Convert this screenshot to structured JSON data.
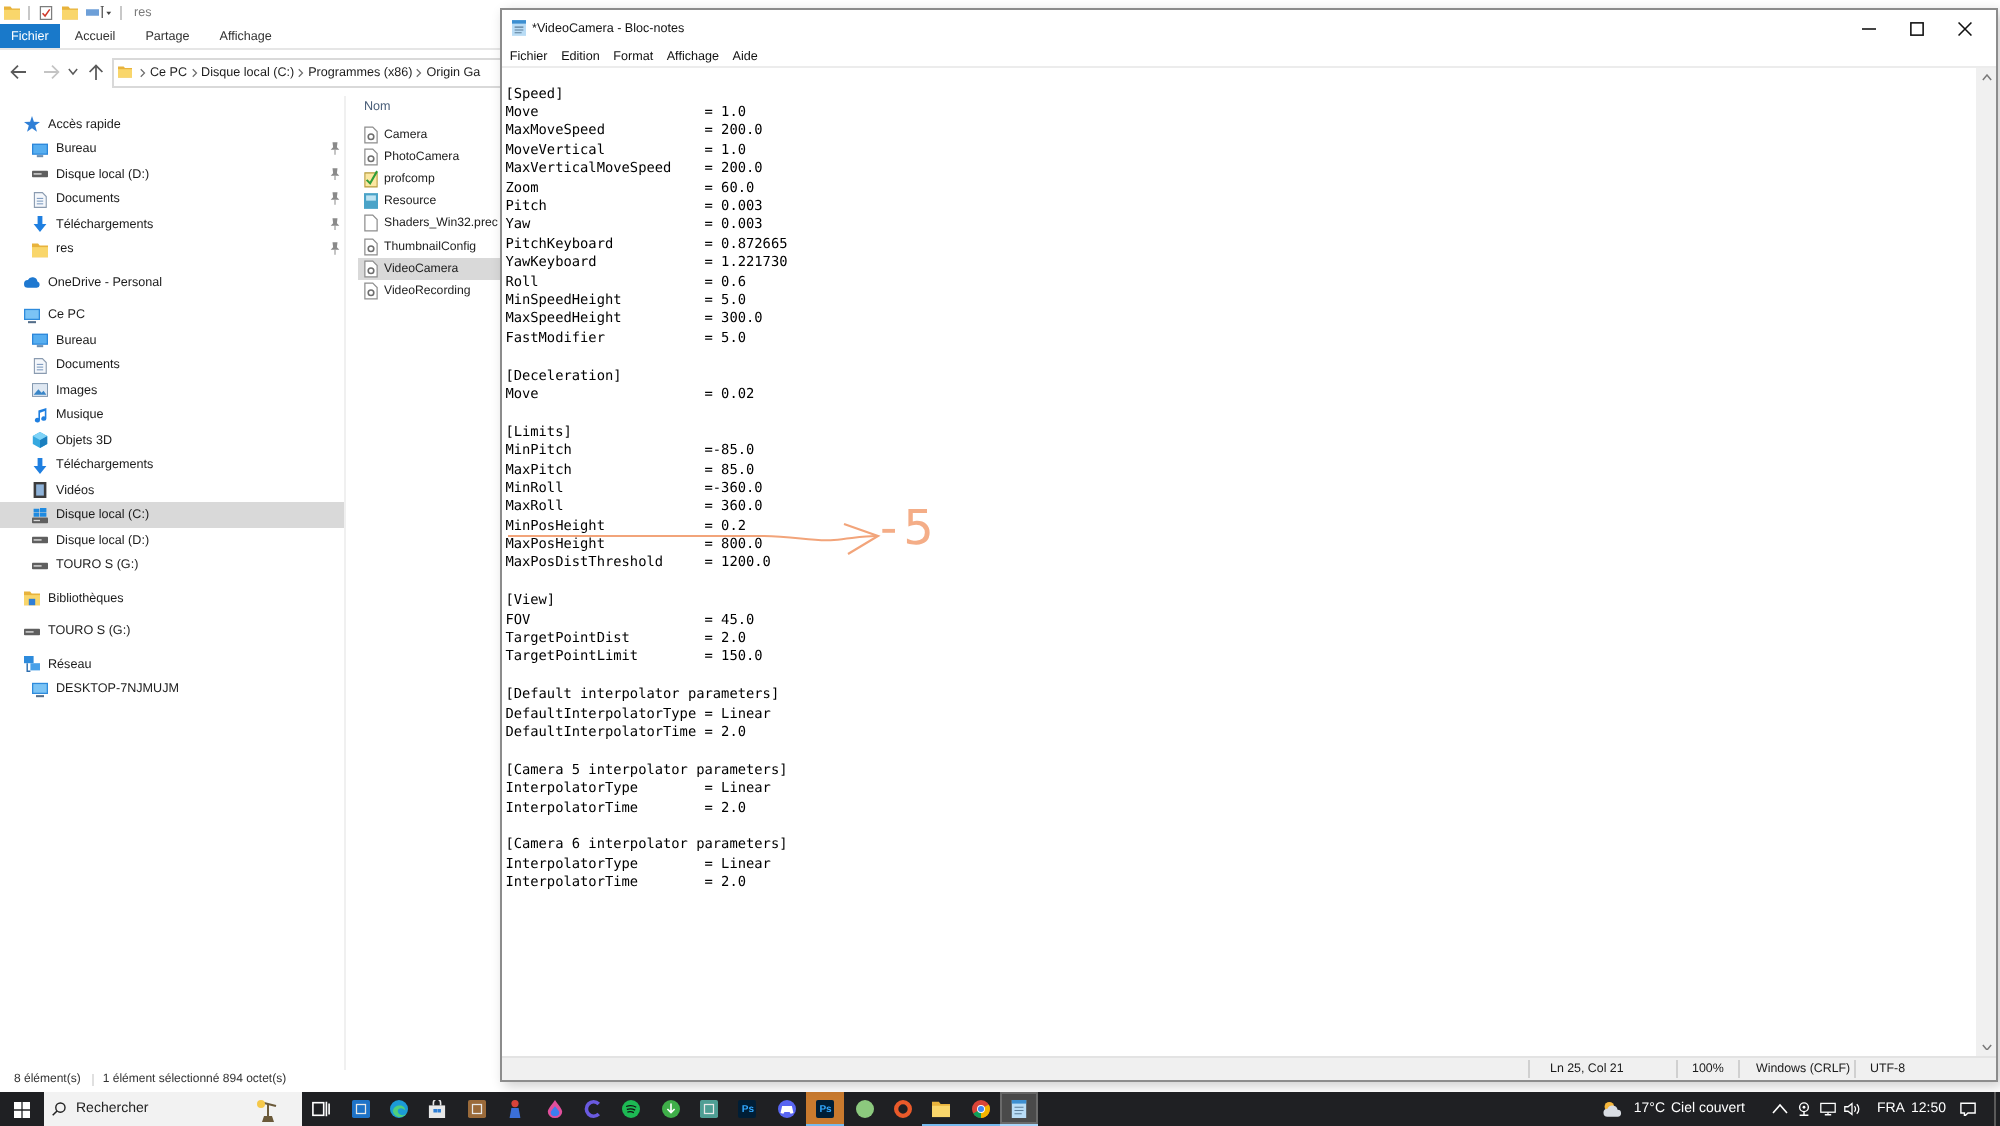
{
  "explorer": {
    "title": "res",
    "ribbon_tabs": [
      {
        "label": "Fichier",
        "kind": "menu"
      },
      {
        "label": "Accueil",
        "kind": "tab"
      },
      {
        "label": "Partage",
        "kind": "tab"
      },
      {
        "label": "Affichage",
        "kind": "tab"
      }
    ],
    "navigation": [
      {
        "kind": "back",
        "disabled": false
      },
      {
        "kind": "forward",
        "disabled": true
      },
      {
        "kind": "recent",
        "disabled": false
      },
      {
        "kind": "up",
        "disabled": false
      }
    ],
    "address_bar": {
      "segments": [
        "Ce PC",
        "Disque local (C:)",
        "Programmes (x86)",
        "Origin Ga"
      ]
    },
    "sidebar": {
      "items": [
        {
          "label": "Accès rapide",
          "kind": "quick-access",
          "pinned": false,
          "selected": false,
          "children": [
            {
              "label": "Bureau",
              "kind": "desktop",
              "pinned": true,
              "selected": false
            },
            {
              "label": "Disque local (D:)",
              "kind": "drive",
              "pinned": true,
              "selected": false
            },
            {
              "label": "Documents",
              "kind": "documents",
              "pinned": true,
              "selected": false
            },
            {
              "label": "Téléchargements",
              "kind": "downloads",
              "pinned": true,
              "selected": false
            },
            {
              "label": "res",
              "kind": "folder",
              "pinned": true,
              "selected": false
            }
          ]
        },
        {
          "label": "OneDrive - Personal",
          "kind": "cloud",
          "pinned": false,
          "selected": false
        },
        {
          "label": "Ce PC",
          "kind": "computer",
          "pinned": false,
          "selected": false,
          "children": [
            {
              "label": "Bureau",
              "kind": "desktop",
              "pinned": false,
              "selected": false
            },
            {
              "label": "Documents",
              "kind": "documents",
              "pinned": false,
              "selected": false
            },
            {
              "label": "Images",
              "kind": "pictures",
              "pinned": false,
              "selected": false
            },
            {
              "label": "Musique",
              "kind": "music",
              "pinned": false,
              "selected": false
            },
            {
              "label": "Objets 3D",
              "kind": "objects",
              "pinned": false,
              "selected": false
            },
            {
              "label": "Téléchargements",
              "kind": "downloads",
              "pinned": false,
              "selected": false
            },
            {
              "label": "Vidéos",
              "kind": "videos",
              "pinned": false,
              "selected": false
            },
            {
              "label": "Disque local (C:)",
              "kind": "system-drive",
              "pinned": false,
              "selected": true
            },
            {
              "label": "Disque local (D:)",
              "kind": "drive",
              "pinned": false,
              "selected": false
            },
            {
              "label": "TOURO S (G:)",
              "kind": "drive",
              "pinned": false,
              "selected": false
            }
          ]
        },
        {
          "label": "Bibliothèques",
          "kind": "libraries",
          "pinned": false,
          "selected": false
        },
        {
          "label": "TOURO S (G:)",
          "kind": "drive",
          "pinned": false,
          "selected": false
        },
        {
          "label": "Réseau",
          "kind": "network",
          "pinned": false,
          "selected": false,
          "children": [
            {
              "label": "DESKTOP-7NJMUJM",
              "kind": "computer",
              "pinned": false,
              "selected": false
            }
          ]
        }
      ]
    },
    "file_list": {
      "column": "Nom",
      "files": [
        {
          "name": "Camera",
          "kind": "settings",
          "selected": false
        },
        {
          "name": "PhotoCamera",
          "kind": "settings",
          "selected": false
        },
        {
          "name": "profcomp",
          "kind": "checklist",
          "selected": false
        },
        {
          "name": "Resource",
          "kind": "package",
          "selected": false
        },
        {
          "name": "Shaders_Win32.prec",
          "kind": "plain",
          "selected": false
        },
        {
          "name": "ThumbnailConfig",
          "kind": "settings",
          "selected": false
        },
        {
          "name": "VideoCamera",
          "kind": "settings",
          "selected": true
        },
        {
          "name": "VideoRecording",
          "kind": "settings",
          "selected": false
        }
      ]
    },
    "status_bar": {
      "count": "8 élément(s)",
      "selection": "1 élément sélectionné 894 octet(s)"
    }
  },
  "notepad": {
    "title": "*VideoCamera - Bloc-notes",
    "menu": [
      "Fichier",
      "Edition",
      "Format",
      "Affichage",
      "Aide"
    ],
    "sections": [
      {
        "header": "[Speed]",
        "lines": [
          "Move                    = 1.0",
          "MaxMoveSpeed            = 200.0",
          "MoveVertical            = 1.0",
          "MaxVerticalMoveSpeed    = 200.0",
          "Zoom                    = 60.0",
          "Pitch                   = 0.003",
          "Yaw                     = 0.003",
          "PitchKeyboard           = 0.872665",
          "YawKeyboard             = 1.221730",
          "Roll                    = 0.6",
          "MinSpeedHeight          = 5.0",
          "MaxSpeedHeight          = 300.0",
          "FastModifier            = 5.0"
        ]
      },
      {
        "header": "[Deceleration]",
        "lines": [
          "Move                    = 0.02"
        ]
      },
      {
        "header": "[Limits]",
        "lines": [
          "MinPitch                =-85.0",
          "MaxPitch                = 85.0",
          "MinRoll                 =-360.0",
          "MaxRoll                 = 360.0",
          "MinPosHeight            = 0.2",
          "MaxPosHeight            = 800.0",
          "MaxPosDistThreshold     = 1200.0"
        ]
      },
      {
        "header": "[View]",
        "lines": [
          "FOV                     = 45.0",
          "TargetPointDist         = 2.0",
          "TargetPointLimit        = 150.0"
        ]
      },
      {
        "header": "[Default interpolator parameters]",
        "lines": [
          "DefaultInterpolatorType = Linear",
          "DefaultInterpolatorTime = 2.0"
        ]
      },
      {
        "header": "[Camera 5 interpolator parameters]",
        "lines": [
          "InterpolatorType        = Linear",
          "InterpolatorTime        = 2.0"
        ]
      },
      {
        "header": "[Camera 6 interpolator parameters]",
        "lines": [
          "InterpolatorType        = Linear",
          "InterpolatorTime        = 2.0"
        ]
      }
    ],
    "annotation": {
      "text": "-5"
    },
    "status_bar": [
      "Ln 25, Col 21",
      "100%",
      "Windows (CRLF)",
      "UTF-8"
    ]
  },
  "taskbar": {
    "search": {
      "placeholder": "Rechercher"
    },
    "apps": [
      {
        "kind": "task-view",
        "running": false,
        "selected": false,
        "flashing": false
      },
      {
        "kind": "square",
        "color": "#1e73c8",
        "running": false,
        "selected": false,
        "flashing": false
      },
      {
        "kind": "swirl",
        "running": false,
        "selected": false,
        "flashing": false
      },
      {
        "kind": "bag",
        "running": false,
        "selected": false,
        "flashing": false
      },
      {
        "kind": "square",
        "color": "#9a6a3a",
        "running": false,
        "selected": false,
        "flashing": false
      },
      {
        "kind": "figure",
        "running": false,
        "selected": false,
        "flashing": false
      },
      {
        "kind": "drop",
        "running": false,
        "selected": false,
        "flashing": false
      },
      {
        "kind": "arc",
        "color": "#6a5ae0",
        "running": false,
        "selected": false,
        "flashing": false
      },
      {
        "kind": "waves",
        "running": false,
        "selected": false,
        "flashing": false
      },
      {
        "kind": "arrow-circle",
        "running": false,
        "selected": false,
        "flashing": false
      },
      {
        "kind": "square",
        "color": "#4f9e94",
        "running": false,
        "selected": false,
        "flashing": false
      },
      {
        "kind": "logo-tile",
        "label": "Ps",
        "running": false,
        "selected": false,
        "flashing": false
      },
      {
        "kind": "controller",
        "running": false,
        "selected": false,
        "flashing": false
      },
      {
        "kind": "logo-tile",
        "label": "Ps",
        "running": true,
        "selected": false,
        "flashing": true
      },
      {
        "kind": "orb",
        "color": "#8cc97e",
        "running": false,
        "selected": false,
        "flashing": false
      },
      {
        "kind": "ring",
        "running": false,
        "selected": false,
        "flashing": false
      },
      {
        "kind": "folder",
        "running": true,
        "selected": false,
        "flashing": false
      },
      {
        "kind": "chrome",
        "running": true,
        "selected": false,
        "flashing": false
      },
      {
        "kind": "notepad",
        "running": true,
        "selected": true,
        "flashing": false
      }
    ],
    "weather": {
      "temperature": "17°C",
      "condition": "Ciel couvert"
    },
    "language": "FRA",
    "time": "12:50"
  }
}
